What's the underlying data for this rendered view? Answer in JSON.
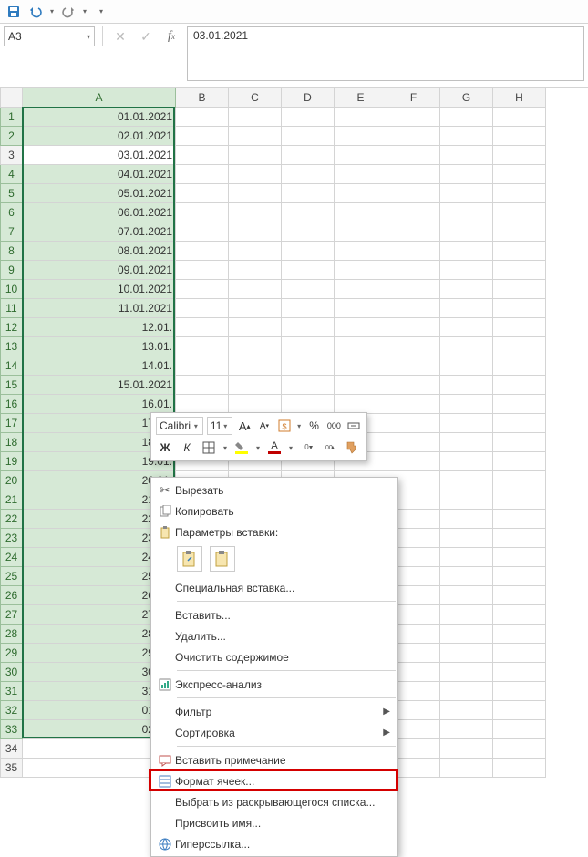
{
  "qat": {
    "save": "save-icon",
    "undo": "undo-icon",
    "redo": "redo-icon"
  },
  "namebox": {
    "value": "A3"
  },
  "formula_bar": {
    "value": "03.01.2021"
  },
  "columns": [
    "A",
    "B",
    "C",
    "D",
    "E",
    "F",
    "G",
    "H"
  ],
  "selected_col": "A",
  "active_row": 3,
  "row_count": 35,
  "data_rows": 33,
  "cells": {
    "A": [
      "01.01.2021",
      "02.01.2021",
      "03.01.2021",
      "04.01.2021",
      "05.01.2021",
      "06.01.2021",
      "07.01.2021",
      "08.01.2021",
      "09.01.2021",
      "10.01.2021",
      "11.01.2021",
      "12.01.",
      "13.01.",
      "14.01.",
      "15.01.2021",
      "16.01.",
      "17.01.",
      "18.01.",
      "19.01.",
      "20.01.",
      "21.01.",
      "22.01.",
      "23.01.",
      "24.01.",
      "25.01.",
      "26.01.",
      "27.01.",
      "28.01.",
      "29.01.",
      "30.01.",
      "31.01.",
      "01.02.",
      "02.02."
    ]
  },
  "mini_toolbar": {
    "font_name": "Calibri",
    "font_size": "11"
  },
  "context_menu": {
    "cut": "Вырезать",
    "copy": "Копировать",
    "paste_header": "Параметры вставки:",
    "paste_special": "Специальная вставка...",
    "insert": "Вставить...",
    "delete": "Удалить...",
    "clear": "Очистить содержимое",
    "quick_analysis": "Экспресс-анализ",
    "filter": "Фильтр",
    "sort": "Сортировка",
    "insert_comment": "Вставить примечание",
    "format_cells": "Формат ячеек...",
    "pick_list": "Выбрать из раскрывающегося списка...",
    "define_name": "Присвоить имя...",
    "hyperlink": "Гиперссылка..."
  }
}
